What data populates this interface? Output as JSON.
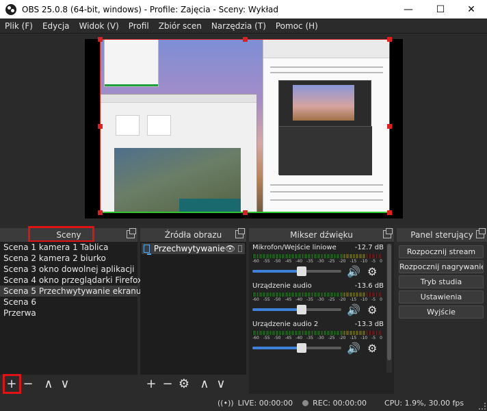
{
  "window": {
    "title": "OBS 25.0.8 (64-bit, windows) - Profile: Zajęcia - Sceny: Wykład"
  },
  "window_controls": {
    "minimize": "—",
    "maximize": "☐",
    "close": "✕"
  },
  "menu": [
    "Plik (F)",
    "Edycja",
    "Widok (V)",
    "Profil",
    "Zbiór scen",
    "Narzędzia (T)",
    "Pomoc (H)"
  ],
  "docks": {
    "scenes": {
      "title": "Sceny"
    },
    "sources": {
      "title": "Źródła obrazu"
    },
    "mixer": {
      "title": "Mikser dźwięku"
    },
    "controls": {
      "title": "Panel sterujący"
    }
  },
  "scenes": [
    {
      "label": "Scena 1  kamera 1 Tablica"
    },
    {
      "label": "Scena 2 kamera 2 biurko"
    },
    {
      "label": "Scena 3 okno dowolnej aplikacji"
    },
    {
      "label": "Scena 4 okno przeglądarki Firefox"
    },
    {
      "label": "Scena 5 Przechwytywanie ekranu",
      "active": true
    },
    {
      "label": "Scena 6"
    },
    {
      "label": "Przerwa"
    }
  ],
  "sources": [
    {
      "label": "Przechwytywanie"
    }
  ],
  "mixer": {
    "scale": [
      "-60",
      "-55",
      "-50",
      "-45",
      "-40",
      "-35",
      "-30",
      "-25",
      "-20",
      "-15",
      "-10",
      "-5",
      "0"
    ],
    "channels": [
      {
        "name": "Mikrofon/Wejście liniowe",
        "db": "-12.7 dB",
        "volume": 0.55
      },
      {
        "name": "Urządzenie audio",
        "db": "-13.6 dB",
        "volume": 0.55
      },
      {
        "name": "Urządzenie audio 2",
        "db": "-13.3 dB",
        "volume": 0.55
      }
    ]
  },
  "controls": [
    {
      "label": "Rozpocznij stream"
    },
    {
      "label": "Rozpocznij nagrywanie"
    },
    {
      "label": "Tryb studia"
    },
    {
      "label": "Ustawienia"
    },
    {
      "label": "Wyjście"
    }
  ],
  "status": {
    "live": "LIVE: 00:00:00",
    "rec": "REC: 00:00:00",
    "cpu": "CPU: 1.9%, 30.00 fps"
  },
  "toolbar_icons": {
    "add": "+",
    "remove": "−",
    "up": "∧",
    "down": "∨",
    "settings": "⚙"
  },
  "colors": {
    "highlight_box": "#e01212",
    "selection": "#e02020",
    "accent_blue": "#3b82d8"
  }
}
